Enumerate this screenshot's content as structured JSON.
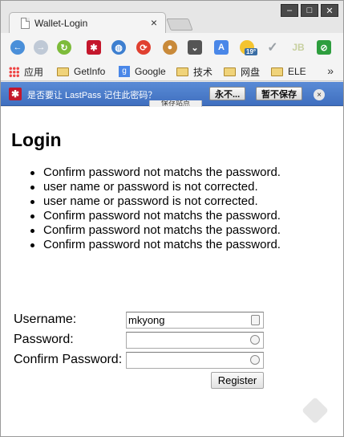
{
  "browser": {
    "tab_title": "Wallet-Login",
    "tab_close": "×",
    "window_controls": {
      "minimize": "–",
      "maximize": "□",
      "close": "✕"
    }
  },
  "toolbar": {
    "icons": [
      "back-icon",
      "forward-icon",
      "reload-icon",
      "lastpass-icon",
      "globe-icon",
      "sync-icon",
      "cookie-icon",
      "pocket-icon",
      "translate-icon",
      "weather-icon",
      "check-icon",
      "jb-icon",
      "adblock-icon"
    ],
    "weather_badge": "19°",
    "jb_label": "JB"
  },
  "bookmarks": {
    "items": [
      {
        "label": "应用",
        "icon": "apps-icon"
      },
      {
        "label": "GetInfo",
        "icon": "folder-icon"
      },
      {
        "label": "Google",
        "icon": "google-bookmark-icon"
      },
      {
        "label": "技术",
        "icon": "folder-icon"
      },
      {
        "label": "网盘",
        "icon": "folder-icon"
      },
      {
        "label": "ELE",
        "icon": "folder-icon"
      }
    ],
    "more": "»"
  },
  "lastpass": {
    "prompt": "是否要让 LastPass 记住此密码？",
    "never_label": "永不...",
    "not_now_label": "暂不保存",
    "close": "×",
    "tooltip": "保存站点"
  },
  "page": {
    "title": "Login",
    "errors": [
      "Confirm password not matchs the password.",
      "user name or password is not corrected.",
      "user name or password is not corrected.",
      "Confirm password not matchs the password.",
      "Confirm password not matchs the password.",
      "Confirm password not matchs the password."
    ],
    "form": {
      "username_label": "Username:",
      "username_value": "mkyong",
      "password_label": "Password:",
      "password_value": "",
      "confirm_label": "Confirm Password:",
      "confirm_value": "",
      "register_label": "Register"
    }
  }
}
